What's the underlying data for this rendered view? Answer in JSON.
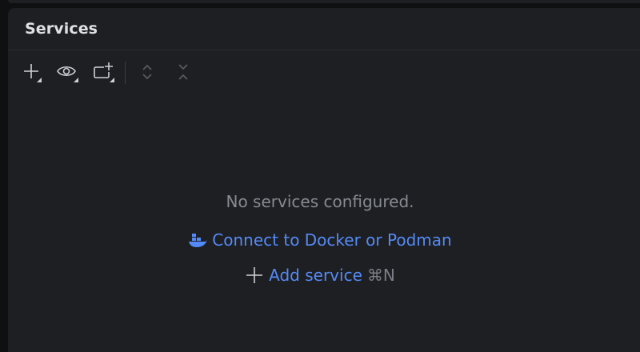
{
  "panel": {
    "title": "Services"
  },
  "toolbar": {
    "icons": [
      "add-icon",
      "eye-icon",
      "new-group-icon",
      "expand-all-icon",
      "collapse-all-icon"
    ]
  },
  "empty_state": {
    "message": "No services configured.",
    "connect_link": "Connect to Docker or Podman",
    "add_link": "Add service",
    "add_shortcut": "⌘N"
  },
  "colors": {
    "background": "#1e1f22",
    "link": "#548af7",
    "muted_text": "#868a91",
    "icon": "#ced0d6",
    "disabled_icon": "#5a5d63"
  }
}
